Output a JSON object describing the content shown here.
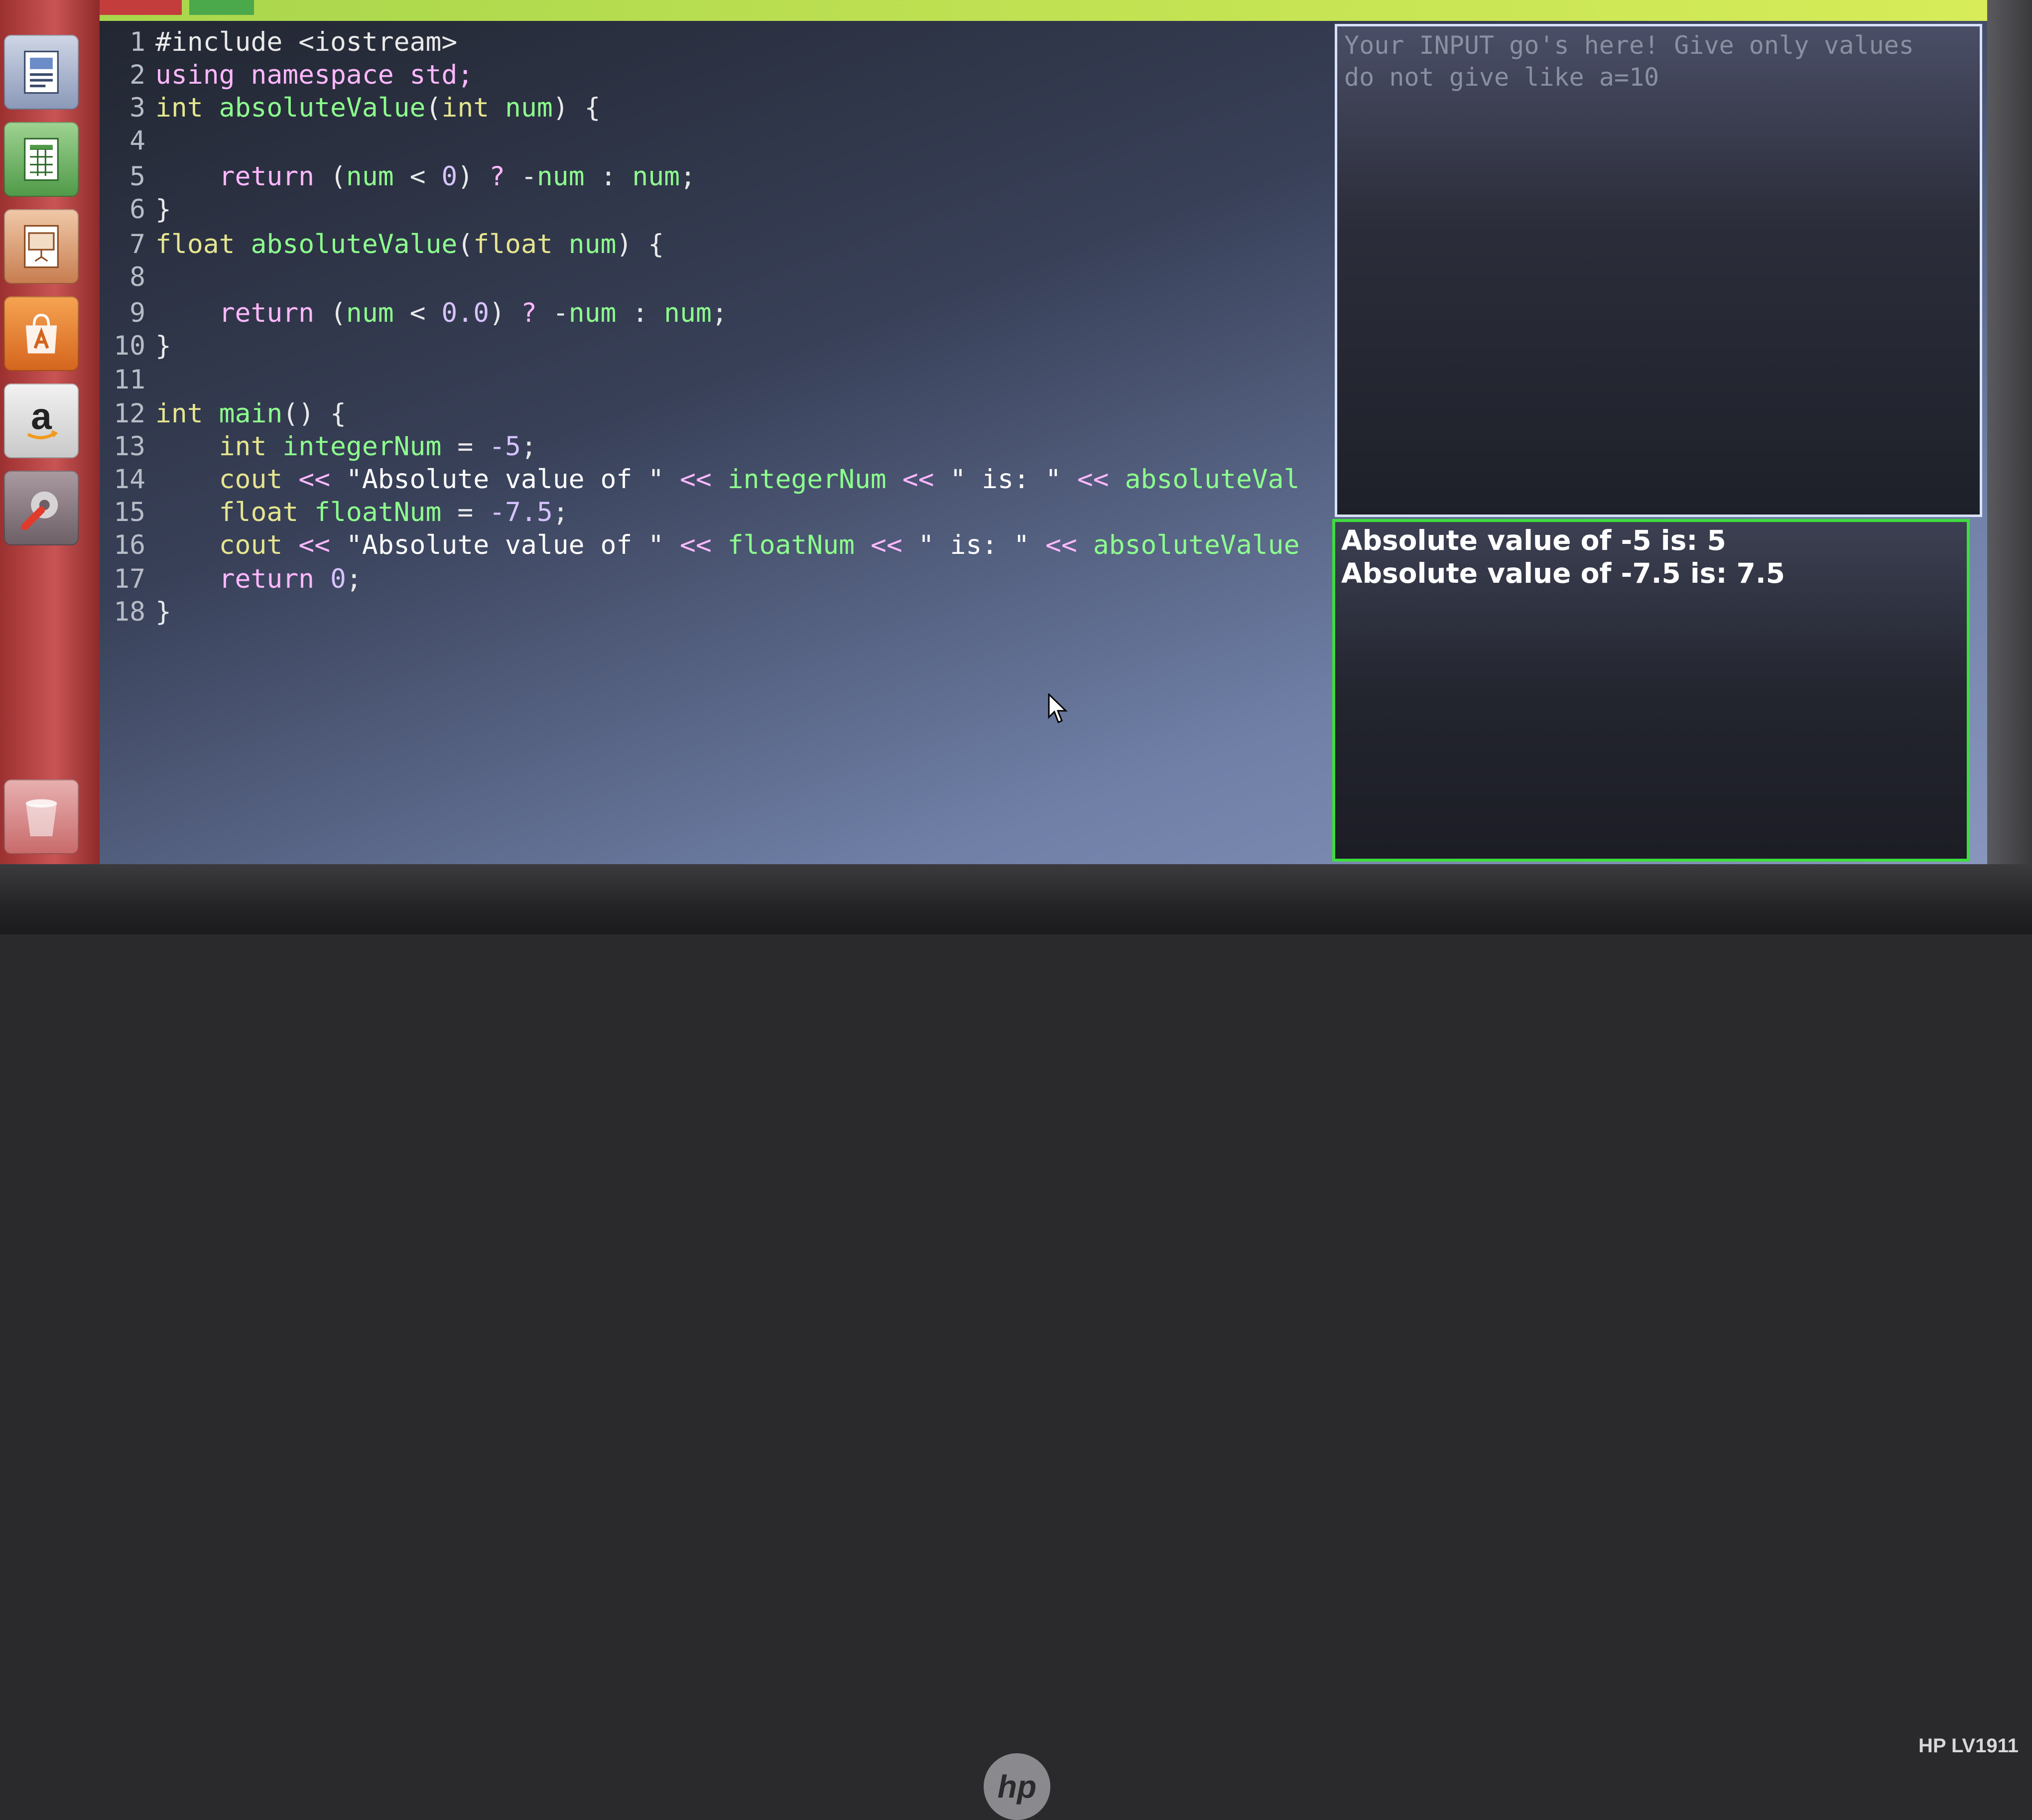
{
  "monitor": {
    "model": "HP LV1911",
    "brand_logo": "hp"
  },
  "launcher": {
    "items": [
      {
        "name": "writer",
        "icon": "document-icon"
      },
      {
        "name": "calc",
        "icon": "spreadsheet-icon"
      },
      {
        "name": "impress",
        "icon": "presentation-icon"
      },
      {
        "name": "software-center",
        "icon": "shopping-bag-icon"
      },
      {
        "name": "amazon",
        "icon": "amazon-icon",
        "glyph": "a"
      },
      {
        "name": "system-settings",
        "icon": "wrench-gear-icon"
      },
      {
        "name": "trash",
        "icon": "trash-icon"
      }
    ]
  },
  "editor": {
    "lines": [
      {
        "n": "1"
      },
      {
        "n": "2"
      },
      {
        "n": "3"
      },
      {
        "n": "4"
      },
      {
        "n": "5"
      },
      {
        "n": "6"
      },
      {
        "n": "7"
      },
      {
        "n": "8"
      },
      {
        "n": "9"
      },
      {
        "n": "10"
      },
      {
        "n": "11"
      },
      {
        "n": "12"
      },
      {
        "n": "13"
      },
      {
        "n": "14"
      },
      {
        "n": "15"
      },
      {
        "n": "16"
      },
      {
        "n": "17"
      },
      {
        "n": "18"
      }
    ],
    "code": {
      "l1": "#include <iostream>",
      "l2_kw": "using namespace",
      "l2_rest": " std;",
      "l3_type": "int",
      "l3_fn": "absoluteValue",
      "l3_open": "(",
      "l3_ptype": "int",
      "l3_pname": " num",
      "l3_close": ") {",
      "l5_kw": "return",
      "l5_a": " (",
      "l5_v1": "num",
      "l5_op": " < ",
      "l5_zero": "0",
      "l5_b": ") ",
      "l5_q": "?",
      "l5_c": " -",
      "l5_v2": "num",
      "l5_colon": " : ",
      "l5_v3": "num",
      "l5_semi": ";",
      "l6": "}",
      "l7_type": "float",
      "l7_fn": "absoluteValue",
      "l7_open": "(",
      "l7_ptype": "float",
      "l7_pname": " num",
      "l7_close": ") {",
      "l9_kw": "return",
      "l9_a": " (",
      "l9_v1": "num",
      "l9_op": " < ",
      "l9_zero": "0.0",
      "l9_b": ") ",
      "l9_q": "?",
      "l9_c": " -",
      "l9_v2": "num",
      "l9_colon": " : ",
      "l9_v3": "num",
      "l9_semi": ";",
      "l10": "}",
      "l12_type": "int",
      "l12_fn": "main",
      "l12_rest": "() {",
      "l13_type": "int",
      "l13_var": " integerNum",
      "l13_eq": " = ",
      "l13_num": "-5",
      "l13_semi": ";",
      "l14_cout": "cout",
      "l14_op1": " << ",
      "l14_str1": "\"Absolute value of \"",
      "l14_op2": " << ",
      "l14_var": "integerNum",
      "l14_op3": " << ",
      "l14_str2": "\" is: \"",
      "l14_op4": " << ",
      "l14_fn": "absoluteVal",
      "l15_type": "float",
      "l15_var": " floatNum",
      "l15_eq": " = ",
      "l15_num": "-7.5",
      "l15_semi": ";",
      "l16_cout": "cout",
      "l16_op1": " << ",
      "l16_str1": "\"Absolute value of \"",
      "l16_op2": " << ",
      "l16_var": "floatNum",
      "l16_op3": " << ",
      "l16_str2": "\" is: \"",
      "l16_op4": " << ",
      "l16_fn": "absoluteValue",
      "l17_kw": "return",
      "l17_num": " 0",
      "l17_semi": ";",
      "l18": "}"
    }
  },
  "input_pane": {
    "placeholder_line1": "Your INPUT go's here! Give only values",
    "placeholder_line2": "do not give like a=10"
  },
  "output_pane": {
    "lines": [
      "Absolute value of -5 is: 5",
      "Absolute value of -7.5 is: 7.5"
    ]
  },
  "colors": {
    "output_border": "#3fdc3f",
    "input_border": "#d8e2ff",
    "launcher": "#c95454",
    "top_strip": "#a8d64c"
  }
}
